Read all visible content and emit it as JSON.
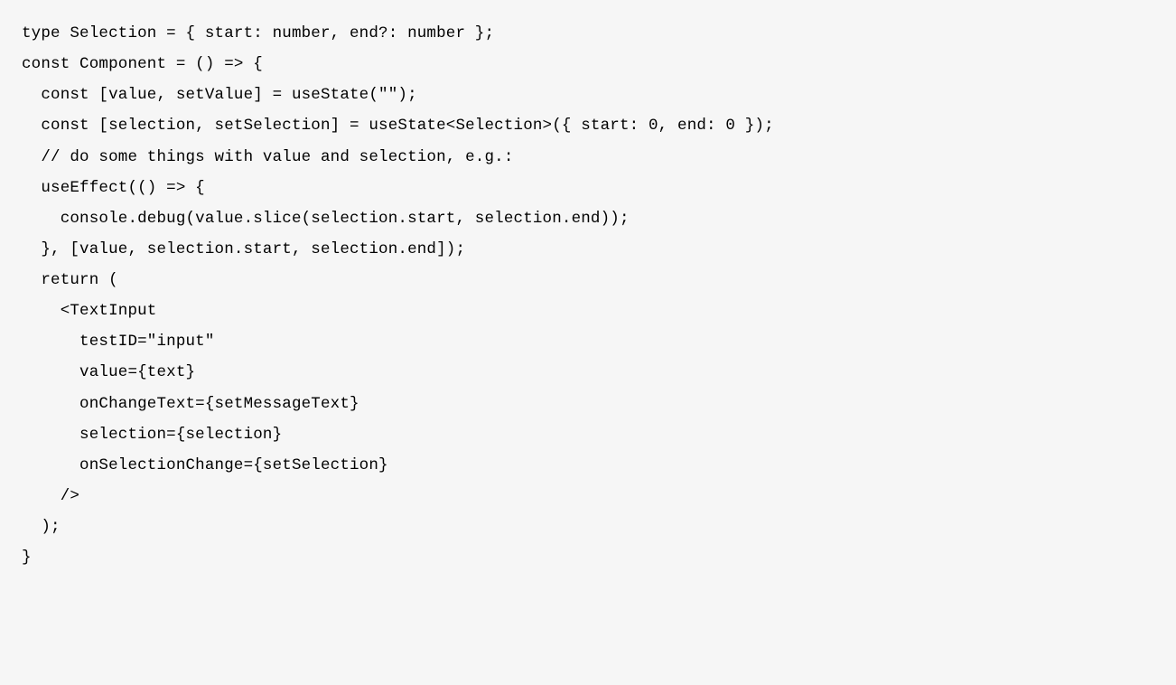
{
  "code": {
    "lines": [
      "type Selection = { start: number, end?: number };",
      "",
      "const Component = () => {",
      "  const [value, setValue] = useState(\"\");",
      "  const [selection, setSelection] = useState<Selection>({ start: 0, end: 0 });",
      "",
      "  // do some things with value and selection, e.g.:",
      "  useEffect(() => {",
      "    console.debug(value.slice(selection.start, selection.end));",
      "  }, [value, selection.start, selection.end]);",
      "",
      "  return (",
      "    <TextInput",
      "      testID=\"input\"",
      "      value={text}",
      "      onChangeText={setMessageText}",
      "      selection={selection}",
      "      onSelectionChange={setSelection}",
      "    />",
      "  );",
      "}"
    ]
  }
}
